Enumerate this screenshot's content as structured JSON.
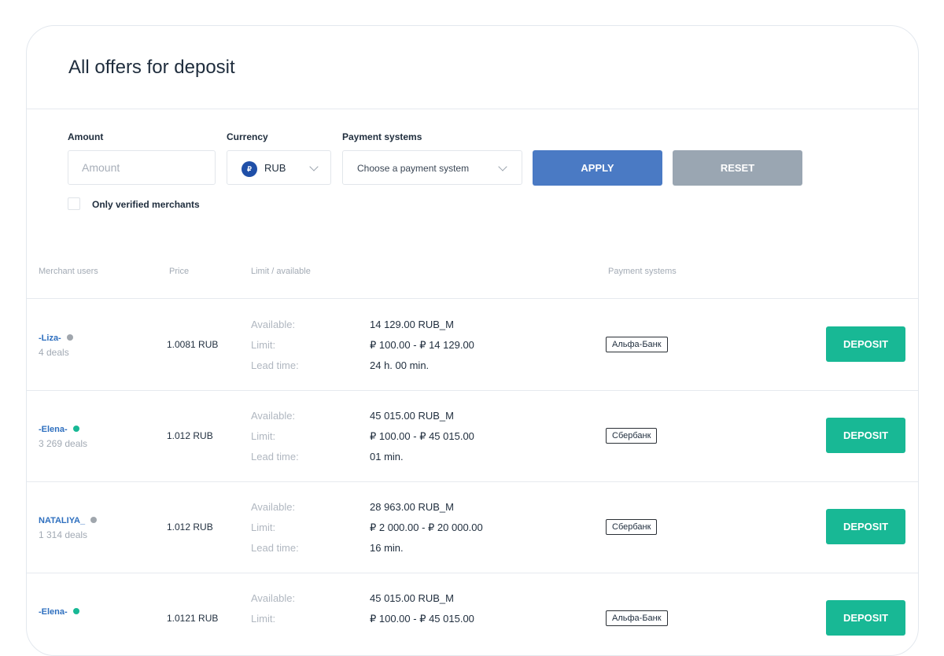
{
  "page": {
    "title": "All offers for deposit"
  },
  "filters": {
    "amount_label": "Amount",
    "amount_placeholder": "Amount",
    "currency_label": "Currency",
    "currency_value": "RUB",
    "currency_icon": "₽",
    "payment_label": "Payment systems",
    "payment_value": "Choose a payment system",
    "apply_label": "APPLY",
    "reset_label": "RESET",
    "verified_label": "Only verified merchants",
    "verified_checked": false
  },
  "table": {
    "headers": {
      "merchant": "Merchant users",
      "price": "Price",
      "limit": "Limit / available",
      "payment": "Payment systems"
    },
    "row_labels": {
      "available": "Available:",
      "limit": "Limit:",
      "lead_time": "Lead time:"
    },
    "deposit_label": "DEPOSIT",
    "rows": [
      {
        "name": "-Liza-",
        "status": "offline",
        "status_color": "#a0a6ad",
        "deals": "4 deals",
        "price": "1.0081 RUB",
        "available": "14 129.00 RUB_M",
        "limit": "₽ 100.00 - ₽ 14 129.00",
        "lead_time": "24 h. 00 min.",
        "bank": "Альфа-Банк"
      },
      {
        "name": "-Elena-",
        "status": "online",
        "status_color": "#18b895",
        "deals": "3 269 deals",
        "price": "1.012 RUB",
        "available": "45 015.00 RUB_M",
        "limit": "₽ 100.00 - ₽ 45 015.00",
        "lead_time": "01 min.",
        "bank": "Сбербанк"
      },
      {
        "name": "NATALIYA_",
        "status": "offline",
        "status_color": "#a0a6ad",
        "deals": "1 314 deals",
        "price": "1.012 RUB",
        "available": "28 963.00 RUB_M",
        "limit": "₽ 2 000.00 - ₽ 20 000.00",
        "lead_time": "16 min.",
        "bank": "Сбербанк"
      },
      {
        "name": "-Elena-",
        "status": "online",
        "status_color": "#18b895",
        "deals": "",
        "price": "1.0121 RUB",
        "available": "45 015.00 RUB_M",
        "limit": "₽ 100.00 - ₽ 45 015.00",
        "lead_time": "",
        "bank": "Альфа-Банк"
      }
    ]
  }
}
